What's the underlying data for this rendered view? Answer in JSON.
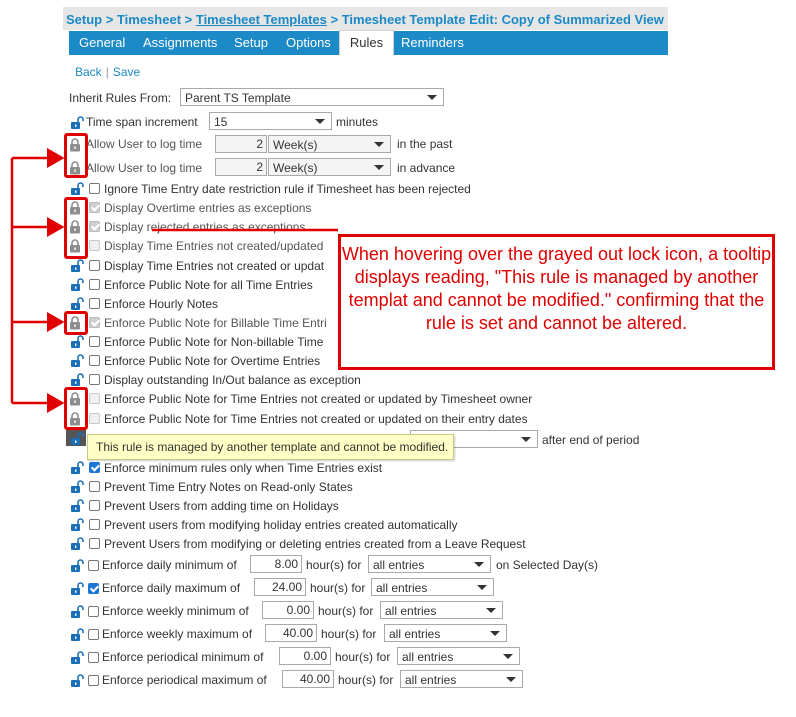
{
  "breadcrumb": {
    "setup": "Setup",
    "sep1": " > ",
    "timesheet": "Timesheet",
    "sep2": " > ",
    "templates": "Timesheet Templates",
    "sep3": " > ",
    "current": "Timesheet Template Edit: Copy of Summarized View"
  },
  "tabs": [
    {
      "label": "General"
    },
    {
      "label": "Assignments"
    },
    {
      "label": "Setup"
    },
    {
      "label": "Options"
    },
    {
      "label": "Rules",
      "active": true
    },
    {
      "label": "Reminders"
    }
  ],
  "links": {
    "back": "Back",
    "separator": "|",
    "save": "Save"
  },
  "inherit": {
    "label": "Inherit Rules From:",
    "value": "Parent TS Template"
  },
  "rules": {
    "timespan": {
      "label": "Time span increment",
      "value": "15",
      "suffix": "minutes"
    },
    "past": {
      "label": "Allow User to log time",
      "number": "2",
      "unit": "Week(s)",
      "suffix": "in the past"
    },
    "advance": {
      "label": "Allow User to log time",
      "number": "2",
      "unit": "Week(s)",
      "suffix": "in advance"
    },
    "ignore_rejected": "Ignore Time Entry date restriction rule if Timesheet has been rejected",
    "overtime_exceptions": "Display Overtime entries as exceptions",
    "rejected_exceptions": "Display rejected entries as exceptions",
    "not_created_updated": "Display Time Entries not created/updated",
    "not_created_or_updated": "Display Time Entries not created or updat",
    "public_note_all": "Enforce Public Note for all Time Entries",
    "hourly_notes": "Enforce Hourly Notes",
    "public_note_billable": "Enforce Public Note for Billable Time Entri",
    "public_note_nonbillable": "Enforce Public Note for Non-billable Time",
    "public_note_overtime": "Enforce Public Note for Overtime Entries",
    "outstanding_balance": "Display outstanding In/Out balance as exception",
    "public_note_owner": "Enforce Public Note for Time Entries not created or updated by Timesheet owner",
    "public_note_dates": "Enforce Public Note for Time Entries not created or updated on their entry dates",
    "after_end": "after end of period",
    "min_rules_only": "Enforce minimum rules only when Time Entries exist",
    "prevent_notes_readonly": "Prevent Time Entry Notes on Read-only States",
    "prevent_holidays": "Prevent Users from adding time on Holidays",
    "prevent_holiday_auto": "Prevent users from modifying holiday entries created automatically",
    "prevent_leave": "Prevent Users from modifying or deleting entries created from a Leave Request",
    "daily_min": {
      "label": "Enforce daily minimum of",
      "value": "8.00",
      "unit": "hour(s) for",
      "option": "all entries",
      "suffix": "on Selected Day(s)"
    },
    "daily_max": {
      "label": "Enforce daily maximum of",
      "value": "24.00",
      "unit": "hour(s) for",
      "option": "all entries"
    },
    "weekly_min": {
      "label": "Enforce weekly minimum of",
      "value": "0.00",
      "unit": "hour(s) for",
      "option": "all entries"
    },
    "weekly_max": {
      "label": "Enforce weekly maximum of",
      "value": "40.00",
      "unit": "hour(s) for",
      "option": "all entries"
    },
    "periodical_min": {
      "label": "Enforce periodical minimum of",
      "value": "0.00",
      "unit": "hour(s) for",
      "option": "all entries"
    },
    "periodical_max": {
      "label": "Enforce periodical maximum of",
      "value": "40.00",
      "unit": "hour(s) for",
      "option": "all entries"
    }
  },
  "tooltip": "This rule is managed by another template and cannot be modified.",
  "callout": "When hovering over the grayed out lock icon, a tooltip displays reading, \"This rule is managed by another templat and cannot be modified.\" confirming that the rule is set and cannot be altered.",
  "colors": {
    "accent": "#1b8ac7",
    "annotation": "#e00000",
    "tooltip_bg": "#ffffc6"
  },
  "icons": {
    "unlocked": "unlocked-padlock-icon",
    "locked": "locked-padlock-icon"
  }
}
